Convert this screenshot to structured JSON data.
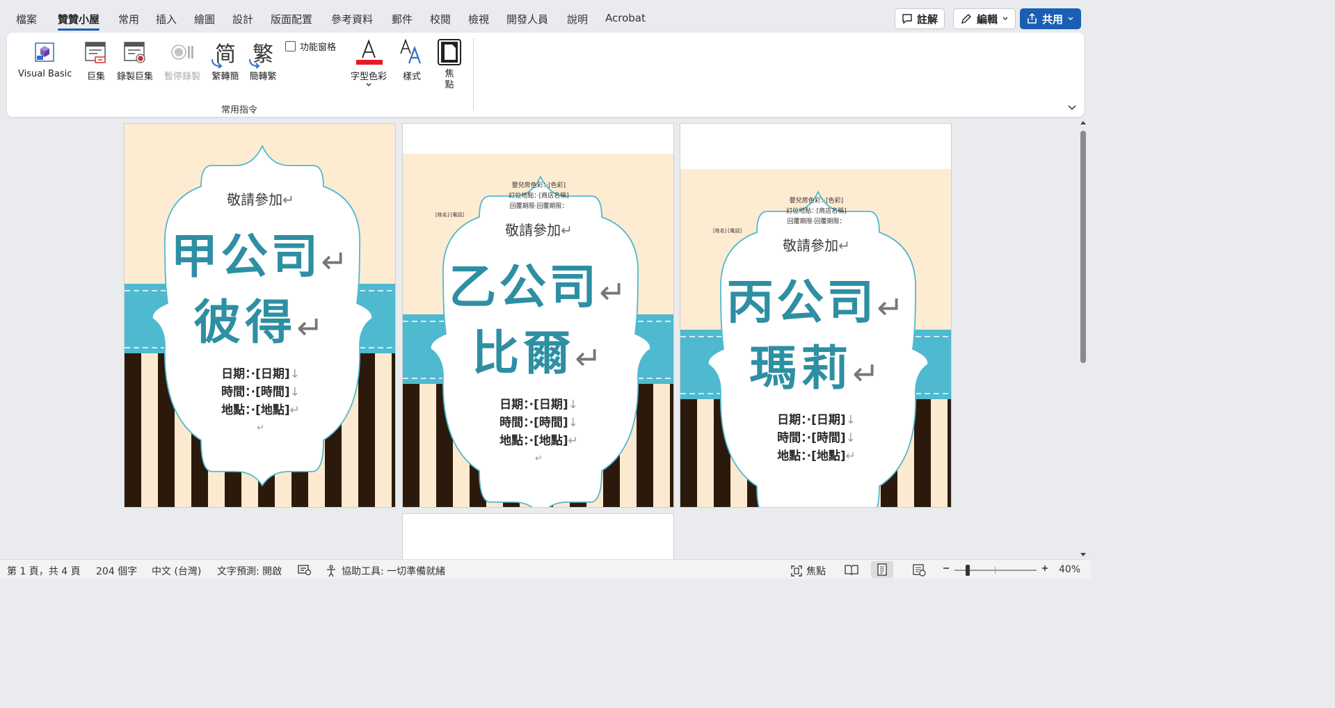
{
  "tabs": [
    {
      "label": "檔案",
      "active": false
    },
    {
      "label": "贊贊小屋",
      "active": true
    },
    {
      "label": "常用",
      "active": false
    },
    {
      "label": "插入",
      "active": false
    },
    {
      "label": "繪圖",
      "active": false
    },
    {
      "label": "設計",
      "active": false
    },
    {
      "label": "版面配置",
      "active": false
    },
    {
      "label": "參考資料",
      "active": false
    },
    {
      "label": "郵件",
      "active": false
    },
    {
      "label": "校閱",
      "active": false
    },
    {
      "label": "檢視",
      "active": false
    },
    {
      "label": "開發人員",
      "active": false
    },
    {
      "label": "說明",
      "active": false
    },
    {
      "label": "Acrobat",
      "active": false
    }
  ],
  "top_buttons": {
    "comments": "註解",
    "editing": "編輯",
    "share": "共用"
  },
  "ribbon": {
    "visual_basic": "Visual Basic",
    "macros": "巨集",
    "record_macro": "錄製巨集",
    "pause_recording": "暫停錄製",
    "trad_to_simp": "繁轉簡",
    "simp_to_trad": "簡轉繁",
    "simp_glyph": "简",
    "trad_glyph": "繁",
    "feature_pane": "功能窗格",
    "font_color": "字型色彩",
    "styles": "樣式",
    "focus_line1": "焦",
    "focus_line2": "點",
    "group_label": "常用指令"
  },
  "colors": {
    "accent_blue": "#1a5fb4",
    "teal_text": "#2e8fa3",
    "teal_band": "#4fb9cf",
    "cream": "#fdecd2",
    "dark_stripe": "#2b1a0c",
    "light_stripe": "#fbeacf",
    "font_color_bar": "#e51c23"
  },
  "pages": [
    {
      "invite": "敬請參加",
      "company": "甲公司",
      "name": "彼得",
      "date_line": "日期：·[日期]",
      "time_line": "時間：·[時間]",
      "place_line": "地點：·[地點]",
      "small_lines": []
    },
    {
      "invite": "敬請參加",
      "company": "乙公司",
      "name": "比爾",
      "date_line": "日期：·[日期]",
      "time_line": "時間：·[時間]",
      "place_line": "地點：·[地點]",
      "small_lines": [
        "嬰兒房色彩：·[色彩]",
        "訂位地點：·[商店名稱]",
        "回覆期限·回覆期限："
      ],
      "side_label": "[姓名]·[電話]"
    },
    {
      "invite": "敬請參加",
      "company": "丙公司",
      "name": "瑪莉",
      "date_line": "日期：·[日期]",
      "time_line": "時間：·[時間]",
      "place_line": "地點：·[地點]",
      "small_lines": [
        "嬰兒房色彩：·[色彩]",
        "訂位地點：·[商店名稱]",
        "回覆期限·回覆期限："
      ],
      "side_label": "[姓名]·[電話]"
    }
  ],
  "status": {
    "page": "第 1 頁，共 4 頁",
    "words": "204 個字",
    "language": "中文 (台灣)",
    "predict": "文字預測: 開啟",
    "accessibility": "協助工具: 一切準備就緒",
    "focus": "焦點",
    "zoom": "40%",
    "zoom_fraction": 0.4
  }
}
